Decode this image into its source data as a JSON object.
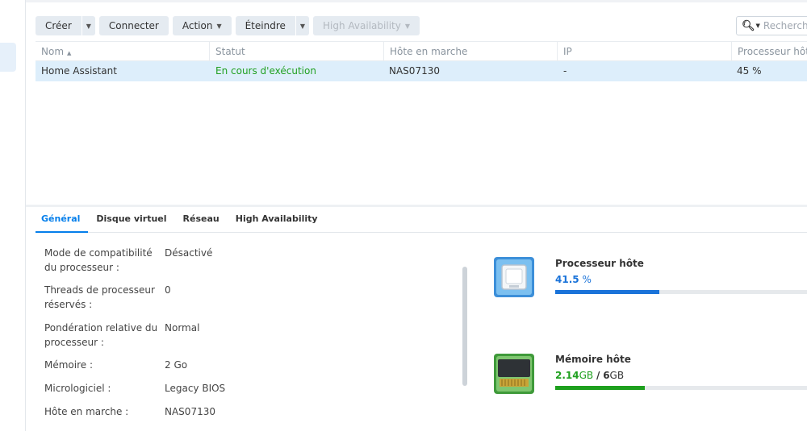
{
  "toolbar": {
    "create": "Créer",
    "connect": "Connecter",
    "action": "Action",
    "shutdown": "Éteindre",
    "ha": "High Availability"
  },
  "search": {
    "placeholder": "Rechercher"
  },
  "grid": {
    "columns": [
      "Nom",
      "Statut",
      "Hôte en marche",
      "IP",
      "Processeur hôte"
    ],
    "rows": [
      {
        "name": "Home Assistant",
        "status": "En cours d'exécution",
        "host": "NAS07130",
        "ip": "-",
        "cpu": "45 %"
      }
    ]
  },
  "tabs": [
    "Général",
    "Disque virtuel",
    "Réseau",
    "High Availability"
  ],
  "properties": [
    {
      "label": "Mode de compatibilité du processeur :",
      "value": "Désactivé"
    },
    {
      "label": "Threads de processeur réservés :",
      "value": "0"
    },
    {
      "label": "Pondération relative du processeur :",
      "value": "Normal"
    },
    {
      "label": "Mémoire :",
      "value": "2 Go"
    },
    {
      "label": "Micrologiciel :",
      "value": "Legacy BIOS"
    },
    {
      "label": "Hôte en marche :",
      "value": "NAS07130"
    }
  ],
  "resources": {
    "cpu": {
      "title": "Processeur hôte",
      "value": "41.5",
      "unit": "%",
      "fraction": 0.415,
      "color": "#1a73d9"
    },
    "memory": {
      "title": "Mémoire hôte",
      "used": "2.14",
      "used_unit": "GB",
      "separator": "/",
      "total": "6",
      "total_unit": "GB",
      "fraction": 0.357,
      "color": "#1ea01e"
    }
  },
  "colors": {
    "accent": "#057feb",
    "running": "#21a021",
    "selected_row": "#ddeefb"
  }
}
